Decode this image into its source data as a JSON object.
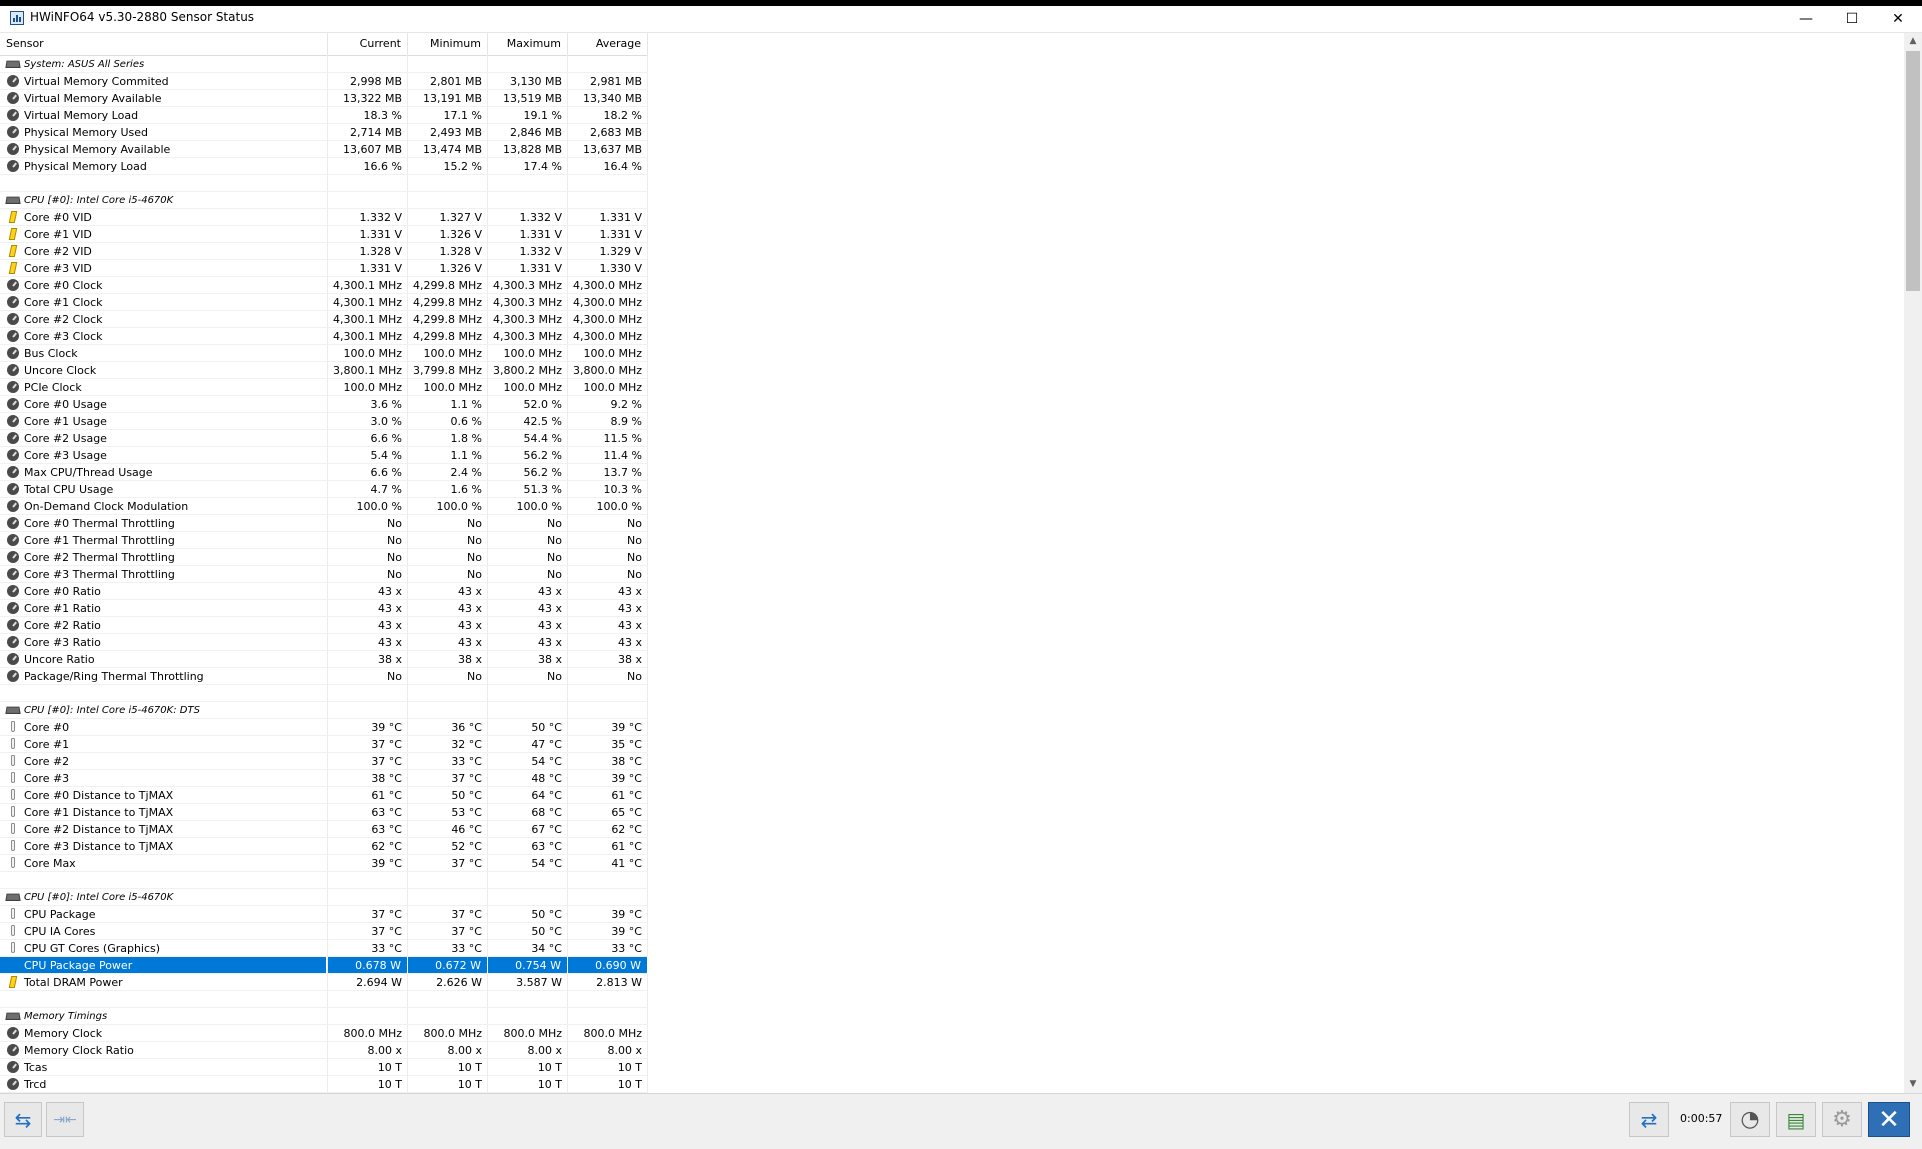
{
  "window": {
    "title": "HWiNFO64 v5.30-2880 Sensor Status",
    "min_glyph": "—",
    "max_glyph": "☐",
    "close_glyph": "✕"
  },
  "columns": [
    "Sensor",
    "Current",
    "Minimum",
    "Maximum",
    "Average"
  ],
  "rows": [
    {
      "type": "group",
      "icon": "chip-icon",
      "label": "System: ASUS All Series"
    },
    {
      "icon": "gauge-icon",
      "label": "Virtual Memory Commited",
      "v": [
        "2,998 MB",
        "2,801 MB",
        "3,130 MB",
        "2,981 MB"
      ]
    },
    {
      "icon": "gauge-icon",
      "label": "Virtual Memory Available",
      "v": [
        "13,322 MB",
        "13,191 MB",
        "13,519 MB",
        "13,340 MB"
      ]
    },
    {
      "icon": "gauge-icon",
      "label": "Virtual Memory Load",
      "v": [
        "18.3 %",
        "17.1 %",
        "19.1 %",
        "18.2 %"
      ]
    },
    {
      "icon": "gauge-icon",
      "label": "Physical Memory Used",
      "v": [
        "2,714 MB",
        "2,493 MB",
        "2,846 MB",
        "2,683 MB"
      ]
    },
    {
      "icon": "gauge-icon",
      "label": "Physical Memory Available",
      "v": [
        "13,607 MB",
        "13,474 MB",
        "13,828 MB",
        "13,637 MB"
      ]
    },
    {
      "icon": "gauge-icon",
      "label": "Physical Memory Load",
      "v": [
        "16.6 %",
        "15.2 %",
        "17.4 %",
        "16.4 %"
      ]
    },
    {
      "type": "blank"
    },
    {
      "type": "group",
      "icon": "chip-icon",
      "label": "CPU [#0]: Intel Core i5-4670K"
    },
    {
      "icon": "voltage-icon",
      "label": "Core #0 VID",
      "v": [
        "1.332 V",
        "1.327 V",
        "1.332 V",
        "1.331 V"
      ]
    },
    {
      "icon": "voltage-icon",
      "label": "Core #1 VID",
      "v": [
        "1.331 V",
        "1.326 V",
        "1.331 V",
        "1.331 V"
      ]
    },
    {
      "icon": "voltage-icon",
      "label": "Core #2 VID",
      "v": [
        "1.328 V",
        "1.328 V",
        "1.332 V",
        "1.329 V"
      ]
    },
    {
      "icon": "voltage-icon",
      "label": "Core #3 VID",
      "v": [
        "1.331 V",
        "1.326 V",
        "1.331 V",
        "1.330 V"
      ]
    },
    {
      "icon": "gauge-icon",
      "label": "Core #0 Clock",
      "v": [
        "4,300.1 MHz",
        "4,299.8 MHz",
        "4,300.3 MHz",
        "4,300.0 MHz"
      ]
    },
    {
      "icon": "gauge-icon",
      "label": "Core #1 Clock",
      "v": [
        "4,300.1 MHz",
        "4,299.8 MHz",
        "4,300.3 MHz",
        "4,300.0 MHz"
      ]
    },
    {
      "icon": "gauge-icon",
      "label": "Core #2 Clock",
      "v": [
        "4,300.1 MHz",
        "4,299.8 MHz",
        "4,300.3 MHz",
        "4,300.0 MHz"
      ]
    },
    {
      "icon": "gauge-icon",
      "label": "Core #3 Clock",
      "v": [
        "4,300.1 MHz",
        "4,299.8 MHz",
        "4,300.3 MHz",
        "4,300.0 MHz"
      ]
    },
    {
      "icon": "gauge-icon",
      "label": "Bus Clock",
      "v": [
        "100.0 MHz",
        "100.0 MHz",
        "100.0 MHz",
        "100.0 MHz"
      ]
    },
    {
      "icon": "gauge-icon",
      "label": "Uncore Clock",
      "v": [
        "3,800.1 MHz",
        "3,799.8 MHz",
        "3,800.2 MHz",
        "3,800.0 MHz"
      ]
    },
    {
      "icon": "gauge-icon",
      "label": "PCIe Clock",
      "v": [
        "100.0 MHz",
        "100.0 MHz",
        "100.0 MHz",
        "100.0 MHz"
      ]
    },
    {
      "icon": "gauge-icon",
      "label": "Core #0 Usage",
      "v": [
        "3.6 %",
        "1.1 %",
        "52.0 %",
        "9.2 %"
      ]
    },
    {
      "icon": "gauge-icon",
      "label": "Core #1 Usage",
      "v": [
        "3.0 %",
        "0.6 %",
        "42.5 %",
        "8.9 %"
      ]
    },
    {
      "icon": "gauge-icon",
      "label": "Core #2 Usage",
      "v": [
        "6.6 %",
        "1.8 %",
        "54.4 %",
        "11.5 %"
      ]
    },
    {
      "icon": "gauge-icon",
      "label": "Core #3 Usage",
      "v": [
        "5.4 %",
        "1.1 %",
        "56.2 %",
        "11.4 %"
      ]
    },
    {
      "icon": "gauge-icon",
      "label": "Max CPU/Thread Usage",
      "v": [
        "6.6 %",
        "2.4 %",
        "56.2 %",
        "13.7 %"
      ]
    },
    {
      "icon": "gauge-icon",
      "label": "Total CPU Usage",
      "v": [
        "4.7 %",
        "1.6 %",
        "51.3 %",
        "10.3 %"
      ]
    },
    {
      "icon": "gauge-icon",
      "label": "On-Demand Clock Modulation",
      "v": [
        "100.0 %",
        "100.0 %",
        "100.0 %",
        "100.0 %"
      ]
    },
    {
      "icon": "gauge-icon",
      "label": "Core #0 Thermal Throttling",
      "v": [
        "No",
        "No",
        "No",
        "No"
      ]
    },
    {
      "icon": "gauge-icon",
      "label": "Core #1 Thermal Throttling",
      "v": [
        "No",
        "No",
        "No",
        "No"
      ]
    },
    {
      "icon": "gauge-icon",
      "label": "Core #2 Thermal Throttling",
      "v": [
        "No",
        "No",
        "No",
        "No"
      ]
    },
    {
      "icon": "gauge-icon",
      "label": "Core #3 Thermal Throttling",
      "v": [
        "No",
        "No",
        "No",
        "No"
      ]
    },
    {
      "icon": "gauge-icon",
      "label": "Core #0 Ratio",
      "v": [
        "43 x",
        "43 x",
        "43 x",
        "43 x"
      ]
    },
    {
      "icon": "gauge-icon",
      "label": "Core #1 Ratio",
      "v": [
        "43 x",
        "43 x",
        "43 x",
        "43 x"
      ]
    },
    {
      "icon": "gauge-icon",
      "label": "Core #2 Ratio",
      "v": [
        "43 x",
        "43 x",
        "43 x",
        "43 x"
      ]
    },
    {
      "icon": "gauge-icon",
      "label": "Core #3 Ratio",
      "v": [
        "43 x",
        "43 x",
        "43 x",
        "43 x"
      ]
    },
    {
      "icon": "gauge-icon",
      "label": "Uncore Ratio",
      "v": [
        "38 x",
        "38 x",
        "38 x",
        "38 x"
      ]
    },
    {
      "icon": "gauge-icon",
      "label": "Package/Ring Thermal Throttling",
      "v": [
        "No",
        "No",
        "No",
        "No"
      ]
    },
    {
      "type": "blank"
    },
    {
      "type": "group",
      "icon": "chip-icon",
      "label": "CPU [#0]: Intel Core i5-4670K: DTS"
    },
    {
      "icon": "thermometer-icon",
      "label": "Core #0",
      "v": [
        "39 °C",
        "36 °C",
        "50 °C",
        "39 °C"
      ]
    },
    {
      "icon": "thermometer-icon",
      "label": "Core #1",
      "v": [
        "37 °C",
        "32 °C",
        "47 °C",
        "35 °C"
      ]
    },
    {
      "icon": "thermometer-icon",
      "label": "Core #2",
      "v": [
        "37 °C",
        "33 °C",
        "54 °C",
        "38 °C"
      ]
    },
    {
      "icon": "thermometer-icon",
      "label": "Core #3",
      "v": [
        "38 °C",
        "37 °C",
        "48 °C",
        "39 °C"
      ]
    },
    {
      "icon": "thermometer-icon",
      "label": "Core #0 Distance to TjMAX",
      "v": [
        "61 °C",
        "50 °C",
        "64 °C",
        "61 °C"
      ]
    },
    {
      "icon": "thermometer-icon",
      "label": "Core #1 Distance to TjMAX",
      "v": [
        "63 °C",
        "53 °C",
        "68 °C",
        "65 °C"
      ]
    },
    {
      "icon": "thermometer-icon",
      "label": "Core #2 Distance to TjMAX",
      "v": [
        "63 °C",
        "46 °C",
        "67 °C",
        "62 °C"
      ]
    },
    {
      "icon": "thermometer-icon",
      "label": "Core #3 Distance to TjMAX",
      "v": [
        "62 °C",
        "52 °C",
        "63 °C",
        "61 °C"
      ]
    },
    {
      "icon": "thermometer-icon",
      "label": "Core Max",
      "v": [
        "39 °C",
        "37 °C",
        "54 °C",
        "41 °C"
      ]
    },
    {
      "type": "blank"
    },
    {
      "type": "group",
      "icon": "chip-icon",
      "label": "CPU [#0]: Intel Core i5-4670K"
    },
    {
      "icon": "thermometer-icon",
      "label": "CPU Package",
      "v": [
        "37 °C",
        "37 °C",
        "50 °C",
        "39 °C"
      ]
    },
    {
      "icon": "thermometer-icon",
      "label": "CPU IA Cores",
      "v": [
        "37 °C",
        "37 °C",
        "50 °C",
        "39 °C"
      ]
    },
    {
      "icon": "thermometer-icon",
      "label": "CPU GT Cores (Graphics)",
      "v": [
        "33 °C",
        "33 °C",
        "34 °C",
        "33 °C"
      ]
    },
    {
      "icon": "voltage-icon",
      "label": "CPU Package Power",
      "v": [
        "0.678 W",
        "0.672 W",
        "0.754 W",
        "0.690 W"
      ],
      "selected": true
    },
    {
      "icon": "voltage-icon",
      "label": "Total DRAM Power",
      "v": [
        "2.694 W",
        "2.626 W",
        "3.587 W",
        "2.813 W"
      ]
    },
    {
      "type": "blank"
    },
    {
      "type": "group",
      "icon": "chip-icon",
      "label": "Memory Timings"
    },
    {
      "icon": "gauge-icon",
      "label": "Memory Clock",
      "v": [
        "800.0 MHz",
        "800.0 MHz",
        "800.0 MHz",
        "800.0 MHz"
      ]
    },
    {
      "icon": "gauge-icon",
      "label": "Memory Clock Ratio",
      "v": [
        "8.00 x",
        "8.00 x",
        "8.00 x",
        "8.00 x"
      ]
    },
    {
      "icon": "gauge-icon",
      "label": "Tcas",
      "v": [
        "10 T",
        "10 T",
        "10 T",
        "10 T"
      ]
    },
    {
      "icon": "gauge-icon",
      "label": "Trcd",
      "v": [
        "10 T",
        "10 T",
        "10 T",
        "10 T"
      ]
    }
  ],
  "footer": {
    "timer": "0:00:57",
    "nav_left_glyph": "⇆",
    "nav_collapse_glyph": "⇥⇤",
    "network_glyph": "⇄",
    "clock_glyph": "◔",
    "report_glyph": "▤",
    "settings_glyph": "⚙",
    "close_glyph": "✕"
  },
  "colors": {
    "selection": "#0078d7",
    "close_button": "#2e6fb5"
  }
}
